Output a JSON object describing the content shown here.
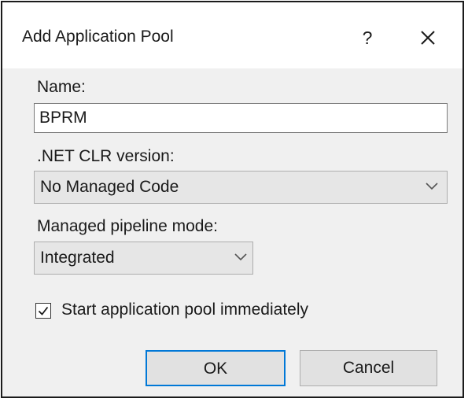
{
  "window": {
    "title": "Add Application Pool",
    "help_label": "?"
  },
  "name_field": {
    "label": "Name:",
    "value": "BPRM"
  },
  "clr_version": {
    "label": ".NET CLR version:",
    "selected": "No Managed Code"
  },
  "pipeline_mode": {
    "label": "Managed pipeline mode:",
    "selected": "Integrated"
  },
  "start_immediately": {
    "label": "Start application pool immediately",
    "checked": true
  },
  "buttons": {
    "ok_label": "OK",
    "cancel_label": "Cancel"
  },
  "colors": {
    "focus_border": "#0078d7",
    "dialog_background": "#f0f0f0"
  },
  "icons": {
    "close": "close-icon",
    "dropdown": "chevron-down-icon",
    "check": "checkmark-icon"
  }
}
